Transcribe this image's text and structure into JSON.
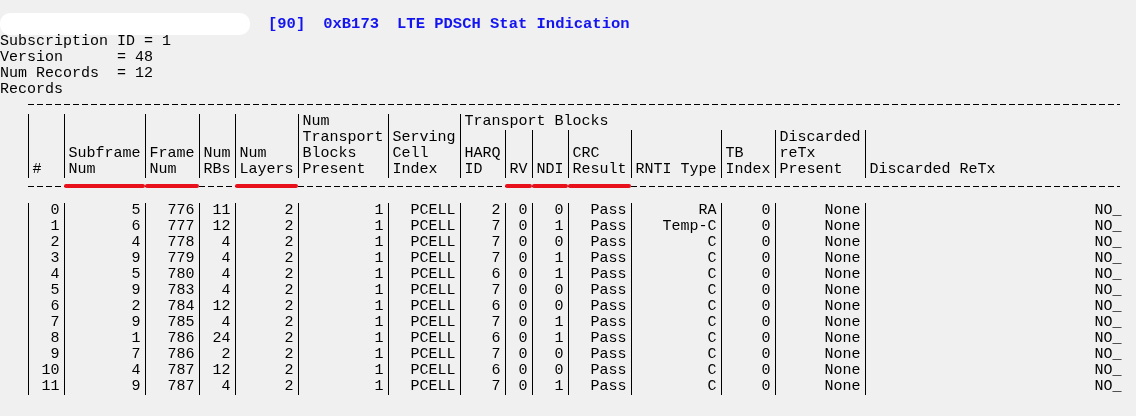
{
  "title": {
    "redacted": true,
    "message_id": "[90]",
    "log_code": "0xB173",
    "name": "LTE PDSCH Stat Indication"
  },
  "summary": [
    "Subscription ID = 1",
    "Version      = 48",
    "Num Records  = 12",
    "Records"
  ],
  "table": {
    "columns": [
      {
        "label": "#",
        "underlined": false
      },
      {
        "label": "Subframe Num",
        "underlined": true
      },
      {
        "label": "Frame Num",
        "underlined": true
      },
      {
        "label": "Num RBs",
        "underlined": false
      },
      {
        "label": "Num Layers",
        "underlined": true
      },
      {
        "label": "Num Transport Blocks Present",
        "underlined": false
      },
      {
        "label": "Serving Cell Index",
        "underlined": false
      }
    ],
    "column_group": {
      "label": "Transport Blocks",
      "columns": [
        {
          "label": "HARQ ID",
          "underlined": false
        },
        {
          "label": "RV",
          "underlined": true
        },
        {
          "label": "NDI",
          "underlined": true
        },
        {
          "label": "CRC Result",
          "underlined": true
        },
        {
          "label": "RNTI Type",
          "underlined": false
        },
        {
          "label": "TB Index",
          "underlined": false
        },
        {
          "label": "Discarded reTx Present",
          "underlined": false
        },
        {
          "label": "Discarded ReTx",
          "underlined": false
        }
      ]
    },
    "rows": [
      [
        "0",
        "5",
        "776",
        "11",
        "2",
        "1",
        "PCELL",
        "2",
        "0",
        "0",
        "Pass",
        "RA",
        "0",
        "None",
        "NO_"
      ],
      [
        "1",
        "6",
        "777",
        "12",
        "2",
        "1",
        "PCELL",
        "7",
        "0",
        "1",
        "Pass",
        "Temp-C",
        "0",
        "None",
        "NO_"
      ],
      [
        "2",
        "4",
        "778",
        "4",
        "2",
        "1",
        "PCELL",
        "7",
        "0",
        "0",
        "Pass",
        "C",
        "0",
        "None",
        "NO_"
      ],
      [
        "3",
        "9",
        "779",
        "4",
        "2",
        "1",
        "PCELL",
        "7",
        "0",
        "1",
        "Pass",
        "C",
        "0",
        "None",
        "NO_"
      ],
      [
        "4",
        "5",
        "780",
        "4",
        "2",
        "1",
        "PCELL",
        "6",
        "0",
        "1",
        "Pass",
        "C",
        "0",
        "None",
        "NO_"
      ],
      [
        "5",
        "9",
        "783",
        "4",
        "2",
        "1",
        "PCELL",
        "7",
        "0",
        "0",
        "Pass",
        "C",
        "0",
        "None",
        "NO_"
      ],
      [
        "6",
        "2",
        "784",
        "12",
        "2",
        "1",
        "PCELL",
        "6",
        "0",
        "0",
        "Pass",
        "C",
        "0",
        "None",
        "NO_"
      ],
      [
        "7",
        "9",
        "785",
        "4",
        "2",
        "1",
        "PCELL",
        "7",
        "0",
        "1",
        "Pass",
        "C",
        "0",
        "None",
        "NO_"
      ],
      [
        "8",
        "1",
        "786",
        "24",
        "2",
        "1",
        "PCELL",
        "6",
        "0",
        "1",
        "Pass",
        "C",
        "0",
        "None",
        "NO_"
      ],
      [
        "9",
        "7",
        "786",
        "2",
        "2",
        "1",
        "PCELL",
        "7",
        "0",
        "0",
        "Pass",
        "C",
        "0",
        "None",
        "NO_"
      ],
      [
        "10",
        "4",
        "787",
        "12",
        "2",
        "1",
        "PCELL",
        "6",
        "0",
        "0",
        "Pass",
        "C",
        "0",
        "None",
        "NO_"
      ],
      [
        "11",
        "9",
        "787",
        "4",
        "2",
        "1",
        "PCELL",
        "7",
        "0",
        "1",
        "Pass",
        "C",
        "0",
        "None",
        "NO_"
      ]
    ]
  }
}
